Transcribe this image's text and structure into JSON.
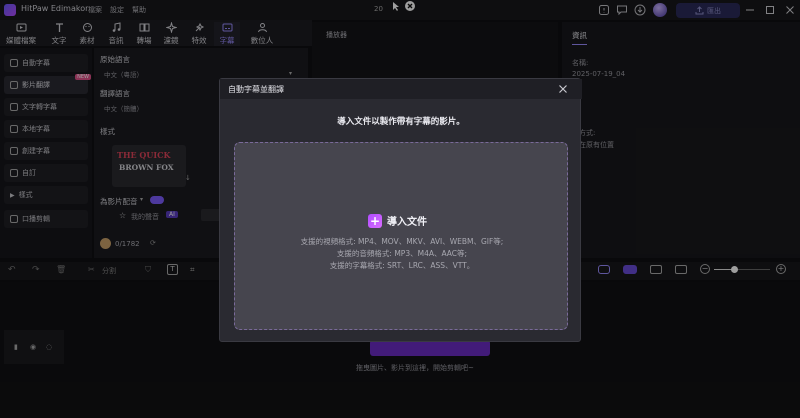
{
  "app": {
    "name": "HitPaw Edimakor",
    "project_title": "20"
  },
  "menu": [
    "檔案",
    "設定",
    "幫助"
  ],
  "header": {
    "export_label": "匯出"
  },
  "toolbar": {
    "items": [
      {
        "label": "媒體檔案",
        "icon": "media-icon"
      },
      {
        "label": "文字",
        "icon": "text-icon"
      },
      {
        "label": "素材",
        "icon": "sticker-icon"
      },
      {
        "label": "音訊",
        "icon": "audio-icon"
      },
      {
        "label": "轉場",
        "icon": "transition-icon"
      },
      {
        "label": "濾鏡",
        "icon": "filter-icon"
      },
      {
        "label": "特效",
        "icon": "effect-icon"
      },
      {
        "label": "字幕",
        "icon": "subtitle-icon"
      },
      {
        "label": "數位人",
        "icon": "avatar-icon"
      }
    ],
    "active": "字幕"
  },
  "sidebar": {
    "items": [
      {
        "label": "自動字幕"
      },
      {
        "label": "影片翻譯",
        "badge": "NEW"
      },
      {
        "label": "文字轉字幕"
      },
      {
        "label": "本地字幕"
      },
      {
        "label": "創建字幕"
      },
      {
        "label": "自訂"
      },
      {
        "label": "樣式"
      },
      {
        "label": "口播剪輯"
      }
    ]
  },
  "panel": {
    "orig_lang_label": "原始語言",
    "orig_lang_value": "中文（粵語）",
    "trans_lang_label": "翻譯語言",
    "trans_lang_value": "中文（簡體）",
    "style_label": "樣式",
    "style_preview_line1": "THE QUICK",
    "style_preview_line2": "BROWN FOX",
    "dub_label": "為影片配音",
    "my_voice_label": "我的聲音",
    "ai_badge": "AI",
    "credits": "0/1782"
  },
  "player": {
    "label": "播放器"
  },
  "right_panel": {
    "tab": "資訊",
    "name_label": "名稱:",
    "name_value": "2025-07-19_04",
    "import_mode_label": "入方式:",
    "import_mode_value": "留在原有位置"
  },
  "modal": {
    "title": "自動字幕並翻譯",
    "subtitle": "導入文件以製作帶有字幕的影片。",
    "import_label": "導入文件",
    "video_formats": "支援的視頻格式: MP4、MOV、MKV、AVI、WEBM、GIF等;",
    "audio_formats": "支援的音頻格式: MP3、M4A、AAC等;",
    "subtitle_formats": "支援的字幕格式: SRT、LRC、ASS、VTT。"
  },
  "timeline": {
    "split_label": "分割",
    "hint": "拖曳圖片、影片到這裡，開始剪輯吧~"
  },
  "colors": {
    "accent": "#9a8cff",
    "brand": "#b04cff",
    "modal_bg": "#2a2a31"
  }
}
